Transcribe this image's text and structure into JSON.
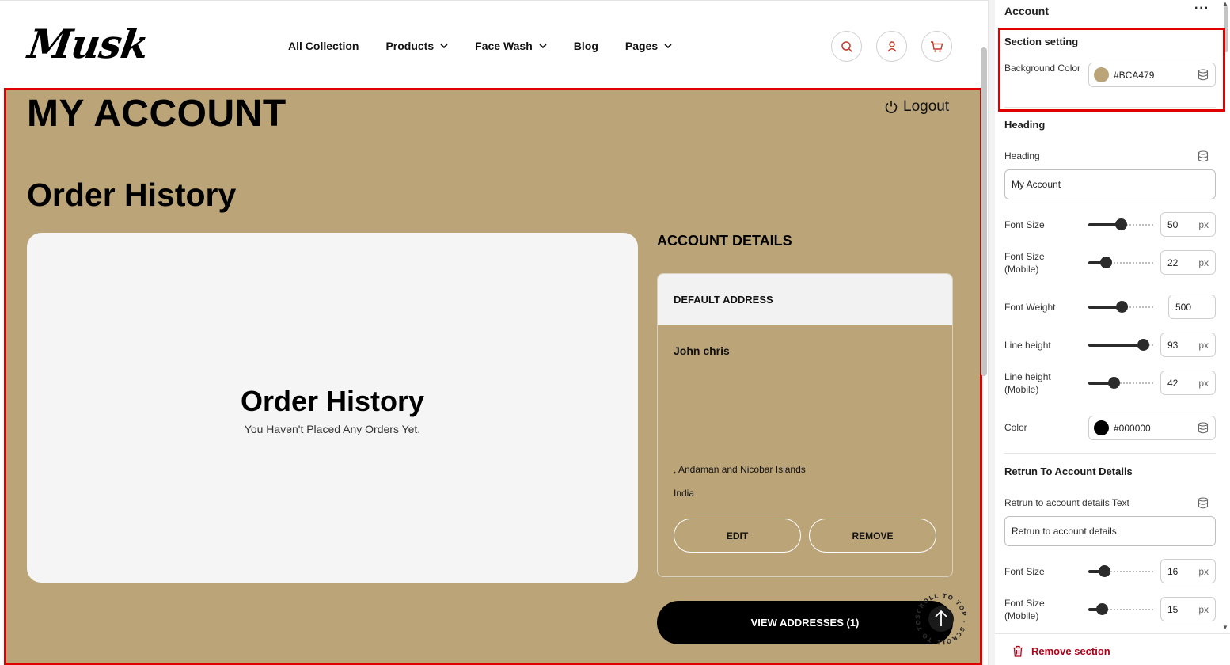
{
  "header": {
    "logo": "Musk",
    "nav": [
      {
        "label": "All Collection",
        "has_dropdown": false
      },
      {
        "label": "Products",
        "has_dropdown": true
      },
      {
        "label": "Face Wash",
        "has_dropdown": true
      },
      {
        "label": "Blog",
        "has_dropdown": false
      },
      {
        "label": "Pages",
        "has_dropdown": true
      }
    ],
    "icons": [
      "search-icon",
      "user-icon",
      "cart-icon"
    ],
    "icon_color": "#c0392b"
  },
  "account": {
    "page_title": "MY ACCOUNT",
    "logout_label": "Logout",
    "order_heading": "Order History",
    "order_card_title": "Order History",
    "order_card_message": "You Haven't Placed Any Orders Yet.",
    "details_title": "ACCOUNT DETAILS",
    "address_header": "DEFAULT ADDRESS",
    "address_name": "John chris",
    "address_line1": ", Andaman and Nicobar Islands",
    "address_line2": "India",
    "edit_label": "EDIT",
    "remove_label": "REMOVE",
    "view_addresses_label": "VIEW ADDRESSES (1)",
    "scroll_top_text": "SCROLL TO TOP - SCROLL TO TOP -",
    "background_color": "#BCA479"
  },
  "panel": {
    "title": "Account",
    "more_label": "···",
    "section_setting": {
      "title": "Section setting",
      "bg_label": "Background Color",
      "bg_value": "#BCA479"
    },
    "heading": {
      "title": "Heading",
      "heading_label": "Heading",
      "heading_value": "My Account",
      "font_size_label": "Font Size",
      "font_size_value": "50",
      "font_size_fill": 0.5,
      "font_size_mobile_label": "Font Size (Mobile)",
      "font_size_mobile_value": "22",
      "font_size_mobile_fill": 0.22,
      "font_weight_label": "Font Weight",
      "font_weight_value": "500",
      "font_weight_fill": 0.52,
      "line_height_label": "Line height",
      "line_height_value": "93",
      "line_height_fill": 0.92,
      "line_height_mobile_label": "Line height (Mobile)",
      "line_height_mobile_value": "42",
      "line_height_mobile_fill": 0.38,
      "color_label": "Color",
      "color_value": "#000000"
    },
    "return": {
      "title": "Retrun To Account Details",
      "text_label": "Retrun to account details Text",
      "text_value": "Retrun to account details",
      "font_size_label": "Font Size",
      "font_size_value": "16",
      "font_size_fill": 0.2,
      "font_size_mobile_label": "Font Size (Mobile)",
      "font_size_mobile_value": "15",
      "font_size_mobile_fill": 0.15
    },
    "unit": "px",
    "remove_section_label": "Remove section"
  }
}
